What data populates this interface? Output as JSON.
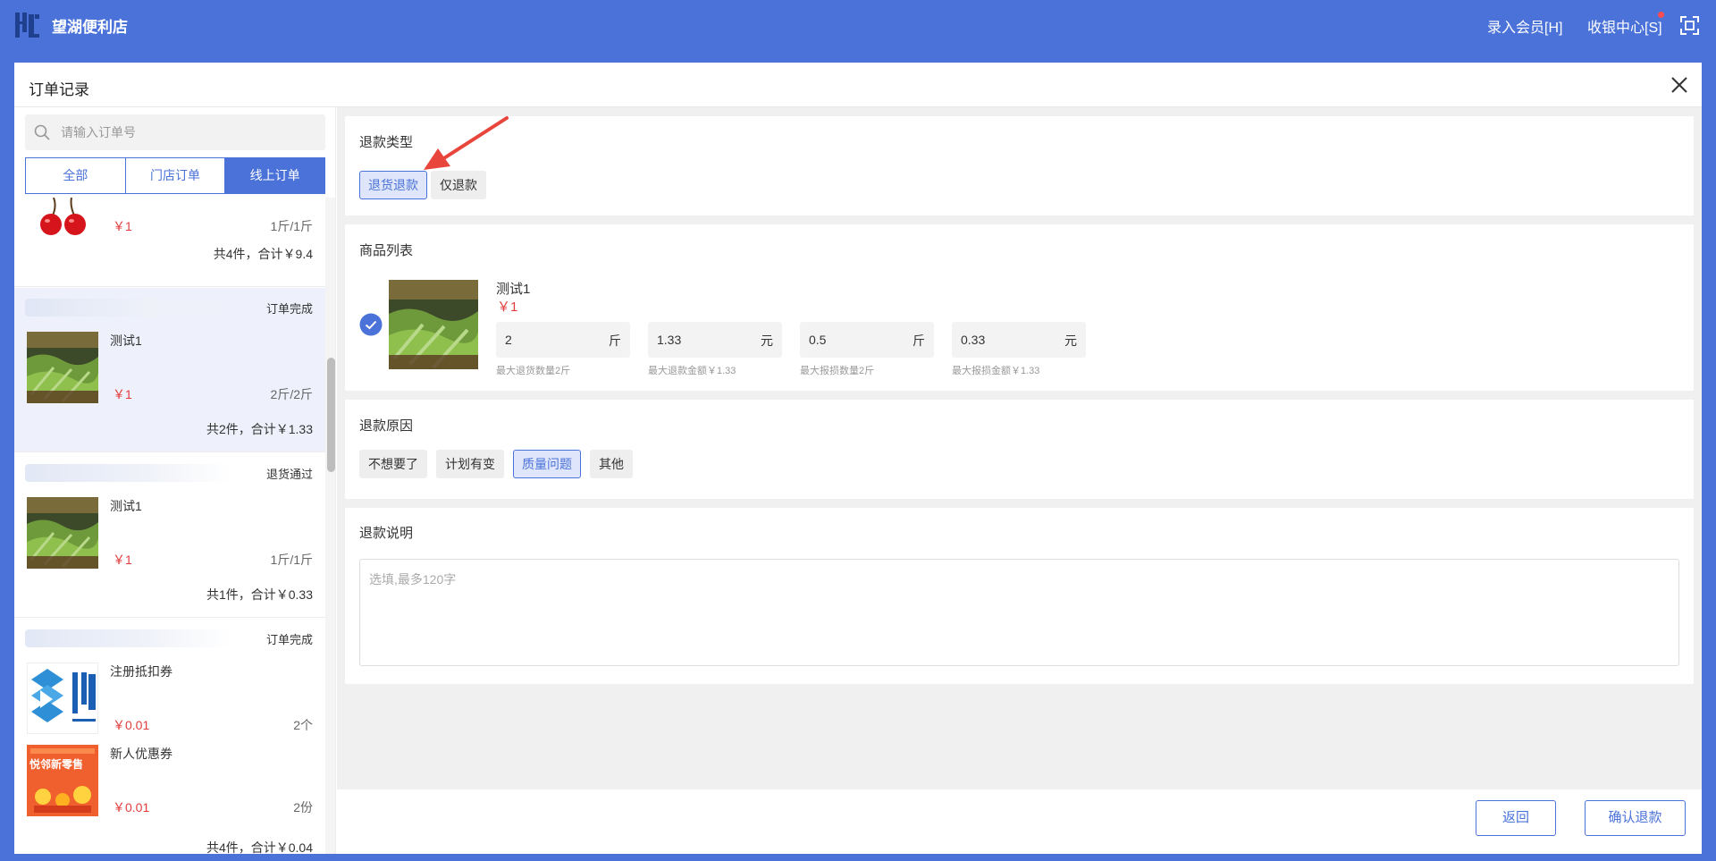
{
  "topbar": {
    "store_name": "望湖便利店",
    "member_link": "录入会员[H]",
    "cashier_link": "收银中心[S]",
    "logo_icon": "app-logo",
    "fullscreen_icon": "fullscreen-icon"
  },
  "modal": {
    "title": "订单记录",
    "close_icon": "close-icon"
  },
  "left": {
    "search_placeholder": "请输入订单号",
    "tabs": [
      "全部",
      "门店订单",
      "线上订单"
    ],
    "active_tab": 2,
    "orders": [
      {
        "items": [
          {
            "name": "",
            "price": "￥1",
            "qty": "1斤/1斤",
            "image": "cherry"
          }
        ],
        "total": "共4件，合计￥9.4"
      },
      {
        "status": "订单完成",
        "items": [
          {
            "name": "测试1",
            "price": "￥1",
            "qty": "2斤/2斤",
            "image": "vegetables"
          }
        ],
        "total": "共2件，合计￥1.33"
      },
      {
        "status": "退货通过",
        "items": [
          {
            "name": "测试1",
            "price": "￥1",
            "qty": "1斤/1斤",
            "image": "vegetables"
          }
        ],
        "total": "共1件，合计￥0.33"
      },
      {
        "status": "订单完成",
        "items": [
          {
            "name": "注册抵扣券",
            "price": "￥0.01",
            "qty": "2个",
            "image": "coupon-logo"
          },
          {
            "name": "新人优惠券",
            "price": "￥0.01",
            "qty": "2份",
            "image": "new-user-coupon",
            "badge": "悦邻新零售"
          }
        ],
        "total": "共4件，合计￥0.04"
      }
    ]
  },
  "refund_type": {
    "title": "退款类型",
    "options": [
      "退货退款",
      "仅退款"
    ],
    "selected": 0
  },
  "product_list": {
    "title": "商品列表",
    "product": {
      "name": "测试1",
      "price": "￥1",
      "checked": true,
      "fields": [
        {
          "value": "2",
          "unit": "斤",
          "hint": "最大退货数量2斤"
        },
        {
          "value": "1.33",
          "unit": "元",
          "hint": "最大退款金额￥1.33"
        },
        {
          "value": "0.5",
          "unit": "斤",
          "hint": "最大报损数量2斤"
        },
        {
          "value": "0.33",
          "unit": "元",
          "hint": "最大报损金额￥1.33"
        }
      ]
    }
  },
  "refund_reason": {
    "title": "退款原因",
    "options": [
      "不想要了",
      "计划有变",
      "质量问题",
      "其他"
    ],
    "selected": 2
  },
  "refund_note": {
    "title": "退款说明",
    "placeholder": "选填,最多120字",
    "value": ""
  },
  "footer": {
    "back_label": "返回",
    "confirm_label": "确认退款"
  },
  "colors": {
    "primary": "#4a72d8",
    "price_red": "#e23c3c",
    "annotation_arrow": "#e8453c"
  }
}
